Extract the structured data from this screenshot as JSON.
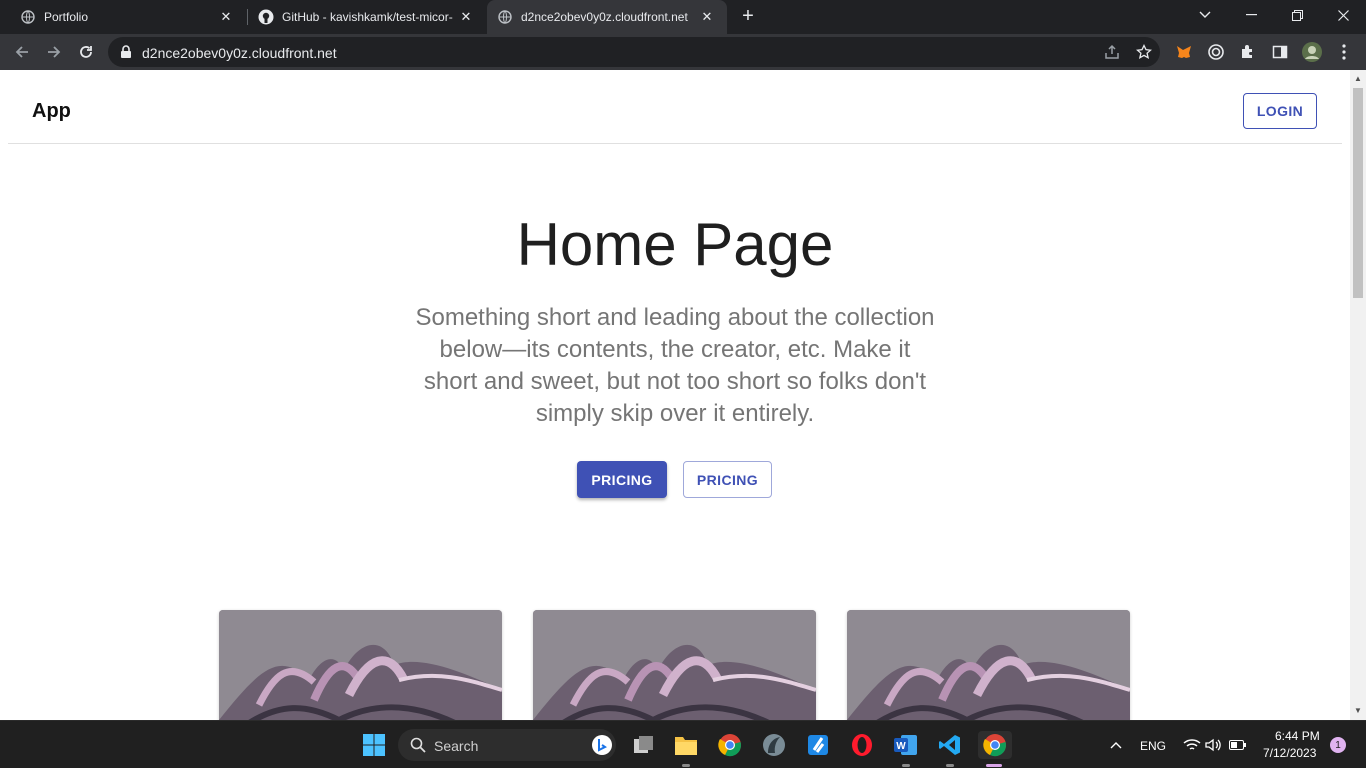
{
  "browser": {
    "tabs": [
      {
        "title": "Portfolio"
      },
      {
        "title": "GitHub - kavishkamk/test-micor-"
      },
      {
        "title": "d2nce2obev0y0z.cloudfront.net"
      }
    ],
    "url": "d2nce2obev0y0z.cloudfront.net"
  },
  "page": {
    "brand": "App",
    "login_label": "LOGIN",
    "hero_title": "Home Page",
    "hero_text": "Something short and leading about the collection below—its contents, the creator, etc. Make it short and sweet, but not too short so folks don't simply skip over it entirely.",
    "primary_button": "PRICING",
    "secondary_button": "PRICING",
    "accent_color": "#3f51b5"
  },
  "taskbar": {
    "search_label": "Search",
    "language": "ENG",
    "time": "6:44 PM",
    "date": "7/12/2023",
    "notification_count": "1"
  }
}
